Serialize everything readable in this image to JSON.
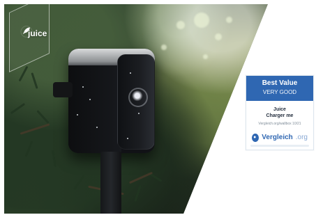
{
  "brand": {
    "name": "juice",
    "icon": "leaf-icon"
  },
  "award": {
    "title": "Best Value",
    "rating": "VERY GOOD",
    "product_line1": "Juice",
    "product_line2": "Charger me",
    "date_text": "Vergleich.org/wallbox 10/21",
    "site_name": "Vergleich",
    "site_tld": ".org",
    "icon": "check-circle-icon"
  },
  "colors": {
    "award_blue": "#2f67b2",
    "foliage_dark": "#1f2e22",
    "foliage_light": "#a7b56f"
  }
}
